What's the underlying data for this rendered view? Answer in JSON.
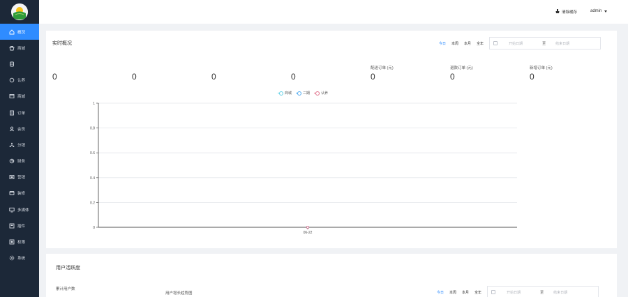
{
  "sidebar": {
    "items": [
      {
        "label": "概况",
        "icon": "home-icon",
        "active": true
      },
      {
        "label": "商城",
        "icon": "shop-icon"
      },
      {
        "label": "",
        "icon": "layers-icon"
      },
      {
        "label": "认养",
        "icon": "adopt-icon"
      },
      {
        "label": "商城",
        "icon": "store-icon"
      },
      {
        "label": "订单",
        "icon": "order-icon"
      },
      {
        "label": "会员",
        "icon": "user-icon"
      },
      {
        "label": "分销",
        "icon": "share-icon"
      },
      {
        "label": "财务",
        "icon": "finance-icon"
      },
      {
        "label": "营销",
        "icon": "marketing-icon"
      },
      {
        "label": "装修",
        "icon": "decorate-icon"
      },
      {
        "label": "多媒体",
        "icon": "media-icon"
      },
      {
        "label": "插件",
        "icon": "plugin-icon"
      },
      {
        "label": "权限",
        "icon": "permission-icon"
      },
      {
        "label": "系统",
        "icon": "settings-icon"
      }
    ]
  },
  "header": {
    "clear_cache": "清除缓存",
    "user": "admin"
  },
  "overview": {
    "title": "实时概况",
    "range_options": [
      "今日",
      "本周",
      "本月",
      "全年"
    ],
    "start_placeholder": "开始日期",
    "separator": "至",
    "end_placeholder": "结束日期",
    "stats": [
      {
        "label": "",
        "value": "0"
      },
      {
        "label": "",
        "value": "0"
      },
      {
        "label": "",
        "value": "0"
      },
      {
        "label": "",
        "value": "0"
      },
      {
        "label": "配送订单 (元)",
        "value": "0"
      },
      {
        "label": "退款订单 (元)",
        "value": "0"
      },
      {
        "label": "新增订单 (元)",
        "value": "0"
      }
    ]
  },
  "chart_data": {
    "type": "line",
    "x": [
      "06-22"
    ],
    "series": [
      {
        "name": "商城",
        "values": [
          0
        ],
        "color": "#5fd0e6"
      },
      {
        "name": "二期",
        "values": [
          0
        ],
        "color": "#4aa8f0"
      },
      {
        "name": "认养",
        "values": [
          0
        ],
        "color": "#e0708a"
      }
    ],
    "y_ticks": [
      "0",
      "0.2",
      "0.4",
      "0.6",
      "0.8",
      "1"
    ],
    "ylim": [
      0,
      1
    ],
    "grid": true,
    "legend": "top-center"
  },
  "activity": {
    "title": "用户活跃度",
    "total_users_label": "累计用户数",
    "trend_label": "用户增长趋势图",
    "range_options": [
      "今日",
      "本周",
      "本月",
      "全年"
    ],
    "start_placeholder": "开始日期",
    "separator": "至",
    "end_placeholder": "结束日期"
  }
}
